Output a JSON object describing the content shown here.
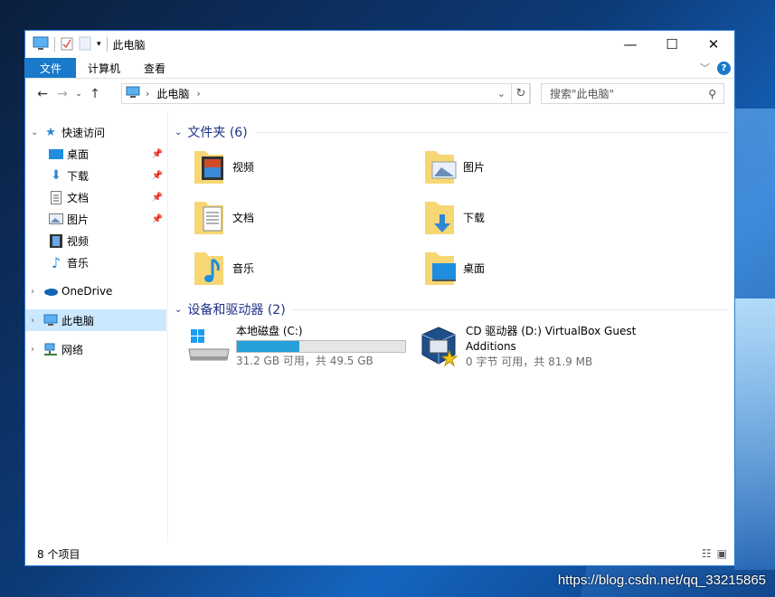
{
  "window": {
    "title": "此电脑",
    "controls": {
      "minimize": "—",
      "maximize": "☐",
      "close": "✕"
    }
  },
  "ribbon": {
    "tabs": [
      "文件",
      "计算机",
      "查看"
    ],
    "collapse_icon": "chevron-down-icon",
    "help": "?"
  },
  "address": {
    "crumb": "此电脑",
    "search_placeholder": "搜索\"此电脑\""
  },
  "nav": {
    "quick_access": "快速访问",
    "quick_items": [
      "桌面",
      "下载",
      "文档",
      "图片",
      "视频",
      "音乐"
    ],
    "onedrive": "OneDrive",
    "this_pc": "此电脑",
    "network": "网络"
  },
  "folders": {
    "header": "文件夹 (6)",
    "items": [
      "视频",
      "图片",
      "文档",
      "下载",
      "音乐",
      "桌面"
    ]
  },
  "devices": {
    "header": "设备和驱动器 (2)",
    "drives": [
      {
        "name": "本地磁盘 (C:)",
        "free": "31.2 GB 可用，共 49.5 GB",
        "used_fraction": 0.37
      },
      {
        "name_line1": "CD 驱动器 (D:) VirtualBox Guest",
        "name_line2": "Additions",
        "free": "0 字节 可用，共 81.9 MB"
      }
    ]
  },
  "status": {
    "count": "8 个项目"
  },
  "watermark": "https://blog.csdn.net/qq_33215865",
  "colors": {
    "accent": "#1979ca",
    "selection": "#cce8ff",
    "header": "#1e3287",
    "bar_fill": "#26a0da"
  }
}
